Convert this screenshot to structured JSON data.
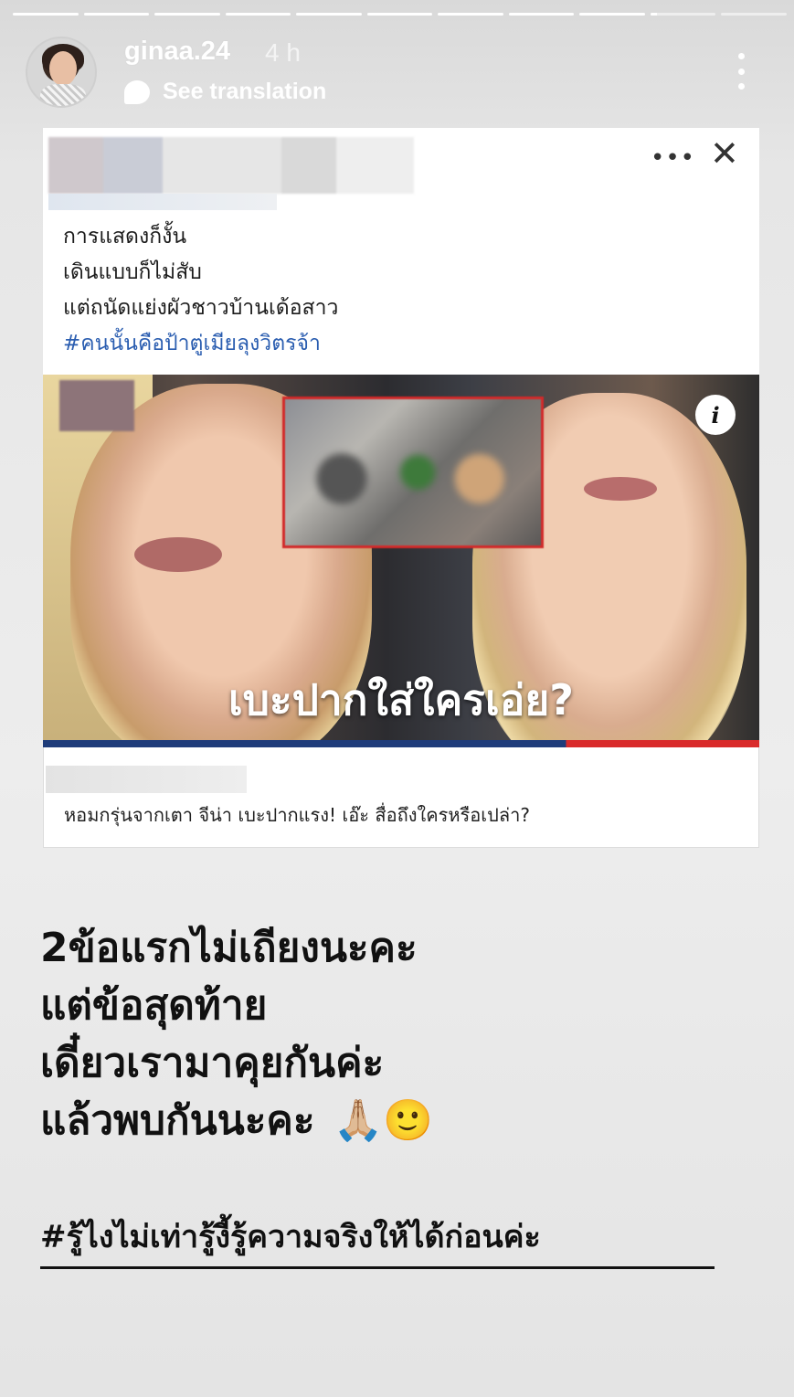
{
  "story": {
    "segments_total": 11,
    "segments_completed": 9,
    "current_segment_progress": 0.1,
    "username": "ginaa.24",
    "time_ago": "4 h",
    "see_translation": "See translation"
  },
  "shared_post": {
    "caption_lines": [
      "การแสดงก็งั้น",
      "เดินแบบก็ไม่สับ",
      "แต่ถนัดแย่งผัวชาวบ้านเด้อสาว"
    ],
    "caption_hashtag": "#คนนั้นคือป้าตู่เมียลุงวิตรจ้า",
    "image_overlay_text": "เบะปากใส่ใครเอ่ย?",
    "info_icon_glyph": "i",
    "link_title": "หอมกรุ่นจากเตา จีน่า เบะปากแรง! เอ๊ะ สื่อถึงใครหรือเปล่า?",
    "more_icon": "more-horizontal-icon",
    "close_icon": "close-icon"
  },
  "story_text": {
    "lines": [
      "2ข้อแรกไม่เถียงนะคะ",
      "แต่ข้อสุดท้าย",
      "เดี๋ยวเรามาคุยกันค่ะ",
      "แล้วพบกันนะคะ"
    ],
    "emojis": "🙏🏼🙂",
    "hashtag": "#รู้ไงไม่เท่ารู้งี้รู้ความจริงให้ได้ก่อนค่ะ"
  },
  "colors": {
    "hashtag_blue": "#2a5db0",
    "strip_blue": "#1f3c7a",
    "strip_red": "#d92a2a",
    "inset_border": "#d22a2a"
  }
}
